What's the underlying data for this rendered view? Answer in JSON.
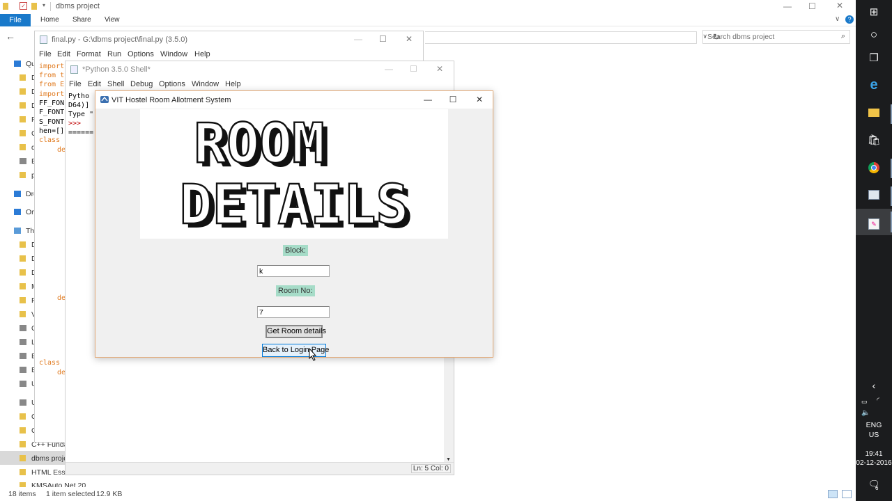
{
  "explorer": {
    "title": "dbms project",
    "tabs": [
      "File",
      "Home",
      "Share",
      "View"
    ],
    "search_placeholder": "Search dbms project",
    "nav_items": [
      {
        "label": "Qu",
        "kind": "star"
      },
      {
        "label": "D",
        "kind": "folder"
      },
      {
        "label": "D",
        "kind": "folder"
      },
      {
        "label": "D",
        "kind": "folder"
      },
      {
        "label": "Pi",
        "kind": "folder"
      },
      {
        "label": "C",
        "kind": "folder"
      },
      {
        "label": "d",
        "kind": "folder"
      },
      {
        "label": "E",
        "kind": "drive"
      },
      {
        "label": "p",
        "kind": "folder"
      },
      {
        "label": "Dro",
        "kind": "dropbox"
      },
      {
        "label": "On",
        "kind": "cloud"
      },
      {
        "label": "Thi",
        "kind": "pc"
      },
      {
        "label": "D",
        "kind": "folder"
      },
      {
        "label": "D",
        "kind": "folder"
      },
      {
        "label": "D",
        "kind": "folder"
      },
      {
        "label": "M",
        "kind": "folder"
      },
      {
        "label": "Pi",
        "kind": "folder"
      },
      {
        "label": "V",
        "kind": "folder"
      },
      {
        "label": "O",
        "kind": "drive"
      },
      {
        "label": "Lo",
        "kind": "drive"
      },
      {
        "label": "E",
        "kind": "drive"
      },
      {
        "label": "E",
        "kind": "drive"
      },
      {
        "label": "U",
        "kind": "drive"
      },
      {
        "label": "UU",
        "kind": "drive"
      },
      {
        "label": "C",
        "kind": "folder"
      },
      {
        "label": "C",
        "kind": "folder"
      },
      {
        "label": "C++ Fundar",
        "kind": "folder"
      },
      {
        "label": "dbms proje",
        "kind": "folder"
      },
      {
        "label": "HTML Essen",
        "kind": "folder"
      },
      {
        "label": "KMSAuto Net 20",
        "kind": "folder"
      }
    ],
    "status": {
      "items": "18 items",
      "selected": "1 item selected",
      "size": "12.9 KB"
    }
  },
  "editor": {
    "title": "final.py - G:\\dbms project\\final.py (3.5.0)",
    "menu": [
      "File",
      "Edit",
      "Format",
      "Run",
      "Options",
      "Window",
      "Help"
    ],
    "code_lines": [
      "import",
      "from t",
      "from E",
      "import",
      "FF_FON",
      "F_FONT",
      "S_FONT",
      "hen=[]",
      "class"
    ],
    "def_label": "de",
    "class_label": "class"
  },
  "shell": {
    "title": "*Python 3.5.0 Shell*",
    "menu": [
      "File",
      "Edit",
      "Shell",
      "Debug",
      "Options",
      "Window",
      "Help"
    ],
    "lines": [
      "Pytho",
      "D64)]",
      "Type \"",
      ">>>",
      "======"
    ],
    "status": "Ln: 5  Col: 0"
  },
  "app": {
    "title": "VIT Hostel Room Allotment System",
    "banner_line1": "ROOM",
    "banner_line2": "DETAILS",
    "block_label": "Block:",
    "block_value": "k",
    "room_label": "Room No:",
    "room_value": "7",
    "get_button": "Get Room details",
    "back_button": "Back to Login Page"
  },
  "taskbar": {
    "lang1": "ENG",
    "lang2": "US",
    "time": "19:41",
    "date": "02-12-2016",
    "notifications": "6"
  },
  "colors": {
    "label_bg": "#a6dcc8",
    "accent": "#0078d7",
    "code_orange": "#e07a1f",
    "shell_red": "#c00000"
  }
}
